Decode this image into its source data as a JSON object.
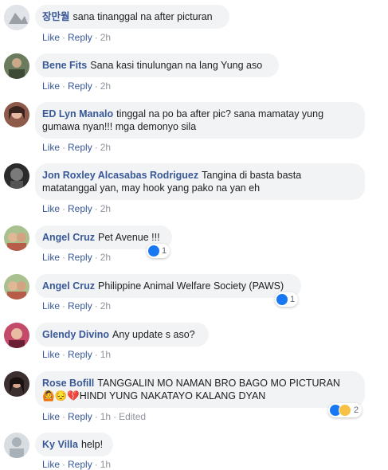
{
  "actions": {
    "like": "Like",
    "reply": "Reply",
    "dot": "·"
  },
  "comments": [
    {
      "author": "장만월",
      "text": "sana tinanggal na after picturan",
      "time": "2h"
    },
    {
      "author": "Bene Fits",
      "text": "Sana kasi tinulungan na lang Yung aso",
      "time": "2h"
    },
    {
      "author": "ED Lyn Manalo",
      "text": "tinggal na po ba after pic? sana mamatay yung gumawa nyan!!! mga demonyo sila",
      "time": "2h"
    },
    {
      "author": "Jon Roxley Alcasabas Rodriguez",
      "text": "Tangina di basta basta matatanggal yan, may hook yang pako na yan eh",
      "time": "2h"
    },
    {
      "author": "Angel Cruz",
      "text": "Pet Avenue !!!",
      "time": "2h",
      "reaction_count": "1"
    },
    {
      "author": "Angel Cruz",
      "text": "Philippine Animal Welfare Society (PAWS)",
      "time": "2h",
      "reaction_count": "1"
    },
    {
      "author": "Glendy Divino",
      "text": "Any update s aso?",
      "time": "1h"
    },
    {
      "author": "Rose Bofill",
      "text": "TANGGALIN MO NAMAN BRO BAGO MO PICTURAN",
      "text2": "🙆😔💔HINDI YUNG NAKATAYO KALANG DYAN",
      "time": "1h",
      "edited": "Edited",
      "reaction_count": "2"
    },
    {
      "author": "Ky Villa",
      "text": "help!",
      "time": "1h"
    }
  ],
  "colors": {
    "link": "#385898",
    "bubble": "#f2f3f5",
    "meta": "#90949c",
    "like_blue": "#1877f2"
  }
}
